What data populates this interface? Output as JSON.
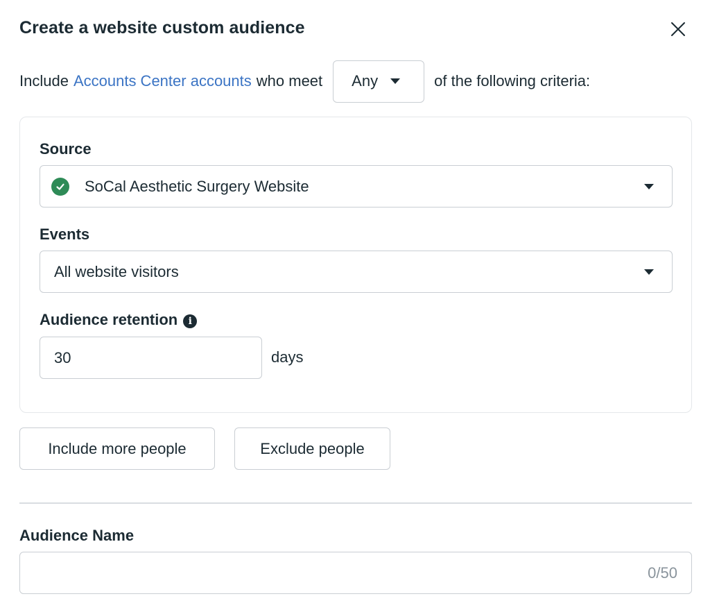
{
  "dialog": {
    "title": "Create a website custom audience",
    "close_icon": "close-icon"
  },
  "criteria": {
    "prefix": "Include",
    "link_text": "Accounts Center accounts",
    "middle": "who meet",
    "match_value": "Any",
    "suffix": "of the following criteria:"
  },
  "rule": {
    "source_label": "Source",
    "source_value": "SoCal Aesthetic Surgery Website",
    "source_status_icon": "check-circle-icon",
    "events_label": "Events",
    "events_value": "All website visitors",
    "retention_label": "Audience retention",
    "retention_info_icon": "info-icon",
    "retention_value": "30",
    "retention_unit": "days"
  },
  "actions": {
    "include_more": "Include more people",
    "exclude": "Exclude people"
  },
  "audience_name": {
    "label": "Audience Name",
    "value": "",
    "counter": "0/50"
  },
  "colors": {
    "link": "#3b74c4",
    "success": "#2e8b57",
    "text": "#1c2b33",
    "border": "#c9ced3"
  }
}
